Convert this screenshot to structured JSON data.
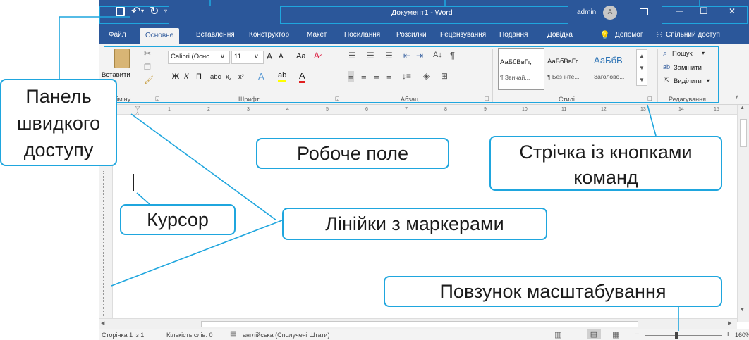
{
  "window": {
    "title": "Документ1 - Word",
    "user": "admin",
    "avatar_letter": "A",
    "minimize_glyph": "—",
    "maximize_glyph": "☐",
    "close_glyph": "✕"
  },
  "quick_access": {
    "save_icon": "save-icon",
    "undo_icon": "undo-icon",
    "redo_icon": "redo-icon",
    "customize_icon": "dropdown-icon"
  },
  "tabs": [
    {
      "label": "Файл"
    },
    {
      "label": "Основне"
    },
    {
      "label": "Вставлення"
    },
    {
      "label": "Конструктор"
    },
    {
      "label": "Макет"
    },
    {
      "label": "Посилання"
    },
    {
      "label": "Розсилки"
    },
    {
      "label": "Рецензування"
    },
    {
      "label": "Подання"
    },
    {
      "label": "Довідка"
    },
    {
      "label": "Допомог"
    },
    {
      "label": "Спільний доступ"
    }
  ],
  "ribbon": {
    "clipboard": {
      "paste": "Вставити",
      "label": "о обміну"
    },
    "font": {
      "name": "Calibri (Осно",
      "size": "11",
      "bold": "Ж",
      "italic": "К",
      "underline": "П",
      "strike": "abc",
      "sub": "x₂",
      "sup": "x²",
      "case": "Aa",
      "grow": "A",
      "shrink": "A",
      "label": "Шрифт"
    },
    "paragraph": {
      "label": "Абзац"
    },
    "styles": {
      "items": [
        {
          "sample": "АаБбВвГг,",
          "name": "¶ Звичай..."
        },
        {
          "sample": "АаБбВвГг,",
          "name": "¶ Без інте..."
        },
        {
          "sample": "АаБбВ",
          "name": "Заголово..."
        }
      ],
      "label": "Стилі"
    },
    "editing": {
      "find": "Пошук",
      "replace": "Замінити",
      "select": "Виділити",
      "label": "Редагування"
    }
  },
  "ruler": {
    "numbers": [
      "1",
      "2",
      "3",
      "4",
      "5",
      "6",
      "7",
      "8",
      "9",
      "10",
      "11",
      "12",
      "13",
      "14",
      "15"
    ]
  },
  "statusbar": {
    "page": "Сторінка 1 із 1",
    "words": "Кількість слів: 0",
    "language": "англійська (Сполучені Штати)",
    "zoom": "160%",
    "minus": "−",
    "plus": "+"
  },
  "callouts": {
    "quick_access": "Панель швидкого доступу",
    "work_area": "Робоче поле",
    "ribbon": "Стрічка із кнопками команд",
    "cursor": "Курсор",
    "rulers": "Лінійки з маркерами",
    "zoom_slider": "Повзунок масштабування"
  },
  "accent": "#1fa6de",
  "word_blue": "#2b579a"
}
